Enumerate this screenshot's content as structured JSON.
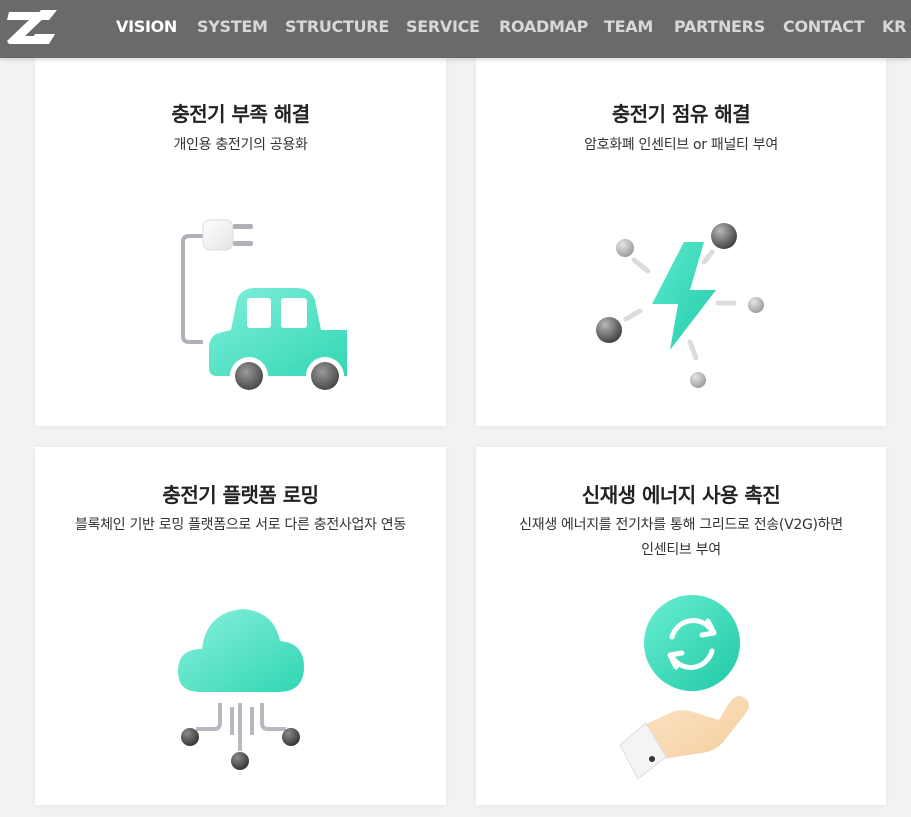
{
  "nav": {
    "items": [
      {
        "label": "VISION"
      },
      {
        "label": "SYSTEM"
      },
      {
        "label": "STRUCTURE"
      },
      {
        "label": "SERVICE"
      },
      {
        "label": "ROADMAP"
      },
      {
        "label": "TEAM"
      },
      {
        "label": "PARTNERS"
      },
      {
        "label": "CONTACT"
      },
      {
        "label": "KR"
      }
    ],
    "active": "VISION"
  },
  "cards": [
    {
      "title": "충전기 부족 해결",
      "desc": "개인용 충전기의 공용화",
      "icon": "ev-car-plug-icon"
    },
    {
      "title": "충전기 점유 해결",
      "desc": "암호화폐 인센티브 or 패널티 부여",
      "icon": "lightning-network-icon"
    },
    {
      "title": "충전기 플랫폼 로밍",
      "desc": "블록체인 기반 로밍 플랫폼으로 서로 다른 충전사업자 연동",
      "icon": "cloud-network-icon"
    },
    {
      "title": "신재생 에너지 사용 촉진",
      "desc_line1": "신재생 에너지를 전기차를 통해 그리드로 전송(V2G)하면",
      "desc_line2": "인센티브 부여",
      "icon": "hand-recycle-icon"
    }
  ],
  "colors": {
    "nav_bg": "#6a6a6a",
    "accent": "#2fd6b4",
    "page_bg": "#f2f2f2"
  }
}
